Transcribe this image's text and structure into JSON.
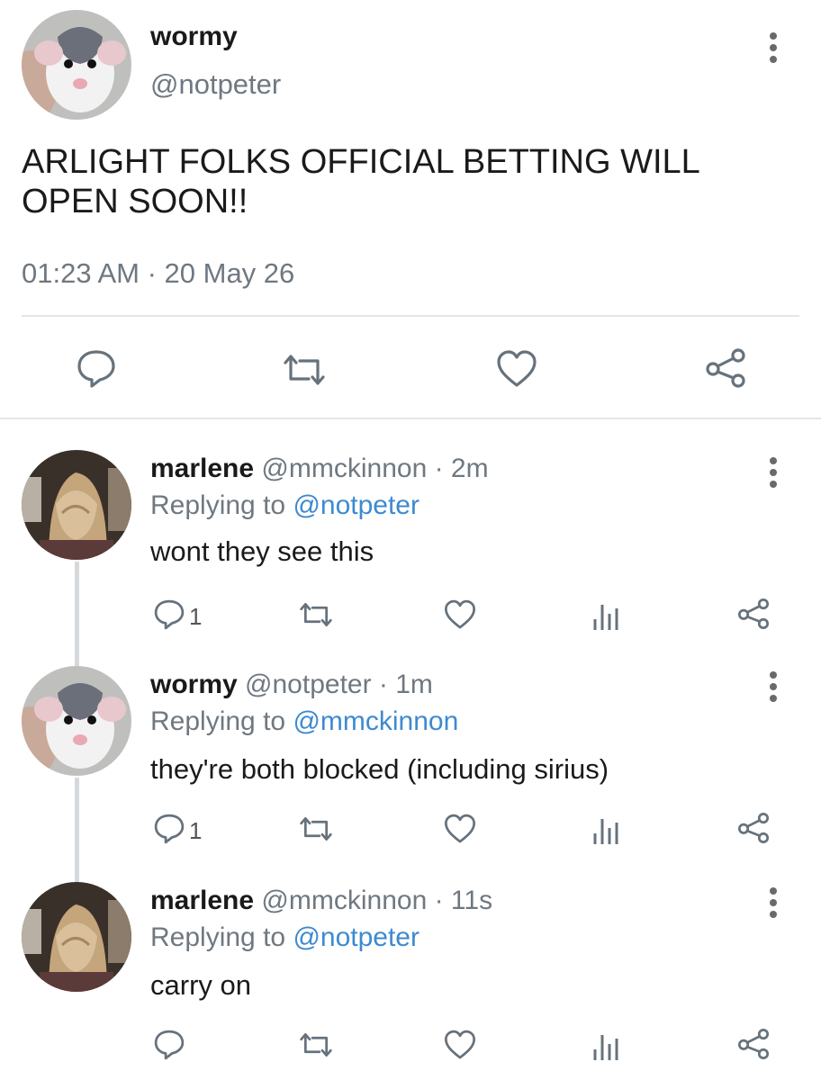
{
  "main_tweet": {
    "name": "wormy",
    "handle": "@notpeter",
    "text_line1": "ARLIGHT FOLKS OFFICIAL BETTING WILL",
    "text_line2": "OPEN SOON!!",
    "timestamp": "01:23 AM · 20 May 26",
    "avatar": "rat-avatar",
    "actions": [
      "reply-icon",
      "retweet-icon",
      "like-icon",
      "share-icon"
    ]
  },
  "replies": [
    {
      "name": "marlene",
      "handle_time": "@mmckinnon · 2m",
      "replying_label": "Replying to ",
      "replying_to": "@notpeter",
      "text": "wont they see this",
      "reply_count": "1",
      "avatar": "blonde-person-avatar"
    },
    {
      "name": "wormy",
      "handle_time": "@notpeter · 1m",
      "replying_label": "Replying to ",
      "replying_to": "@mmckinnon",
      "text": "they're both blocked (including sirius)",
      "reply_count": "1",
      "avatar": "rat-avatar"
    },
    {
      "name": "marlene",
      "handle_time": "@mmckinnon · 11s",
      "replying_label": "Replying to ",
      "replying_to": "@notpeter",
      "text": "carry on",
      "reply_count": "",
      "avatar": "blonde-person-avatar"
    }
  ],
  "colors": {
    "mention": "#3d8ad1",
    "muted": "#6f7880",
    "icon": "#66727c",
    "divider": "#e3e6e8"
  }
}
